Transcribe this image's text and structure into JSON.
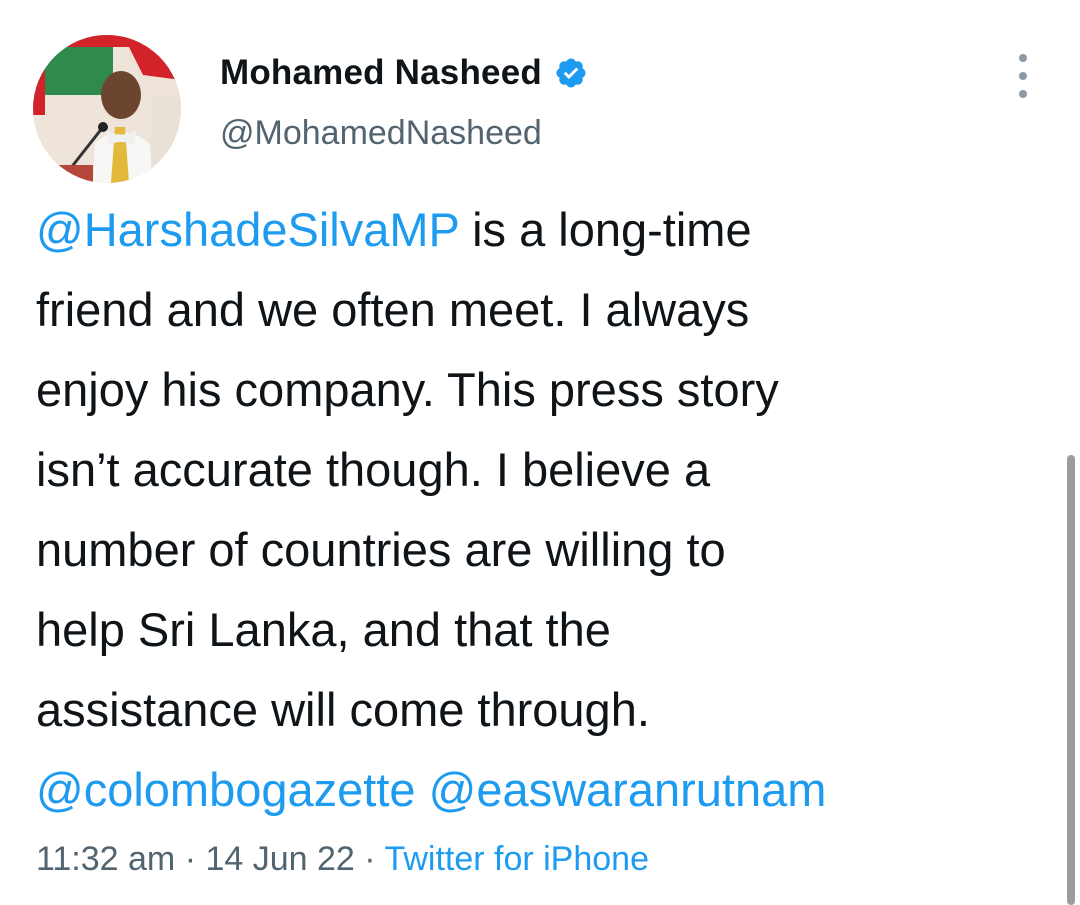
{
  "author": {
    "name": "Mohamed Nasheed",
    "handle": "@MohamedNasheed",
    "verified": true
  },
  "tweet": {
    "lines": [
      {
        "mention": "@HarshadeSilvaMP",
        "text": " is a long-time"
      },
      {
        "text": "friend and we often meet. I always"
      },
      {
        "text": "enjoy his company. This press story"
      },
      {
        "text": "isn’t accurate though. I believe a"
      },
      {
        "text": "number of countries are willing to"
      },
      {
        "text": "help Sri Lanka, and that the"
      },
      {
        "text": "assistance will come through."
      },
      {
        "mention1": "@colombogazette",
        "sep": " ",
        "mention2": "@easwaranrutnam"
      }
    ]
  },
  "meta": {
    "time": "11:32 am",
    "sep1": " · ",
    "date": "14 Jun 22",
    "sep2": " · ",
    "source": "Twitter for iPhone"
  },
  "icons": {
    "verified": "verified-badge-icon",
    "more": "more-vertical-icon"
  },
  "colors": {
    "link": "#1d9bf0",
    "text": "#0f1419",
    "secondary": "#536471"
  }
}
